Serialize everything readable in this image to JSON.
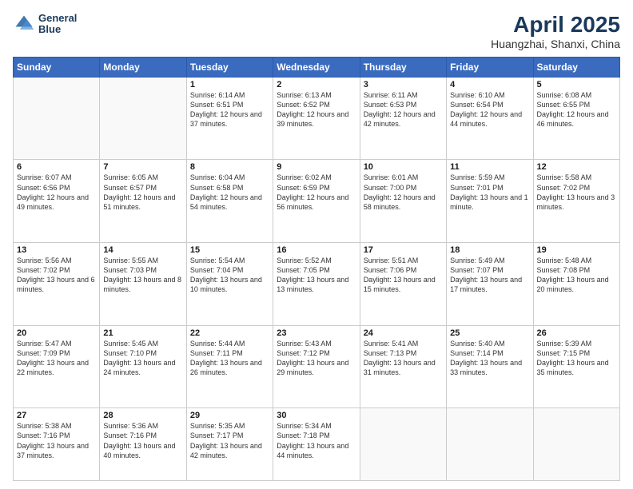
{
  "header": {
    "logo_line1": "General",
    "logo_line2": "Blue",
    "title": "April 2025",
    "subtitle": "Huangzhai, Shanxi, China"
  },
  "days_of_week": [
    "Sunday",
    "Monday",
    "Tuesday",
    "Wednesday",
    "Thursday",
    "Friday",
    "Saturday"
  ],
  "weeks": [
    [
      {
        "day": "",
        "info": ""
      },
      {
        "day": "",
        "info": ""
      },
      {
        "day": "1",
        "info": "Sunrise: 6:14 AM\nSunset: 6:51 PM\nDaylight: 12 hours and 37 minutes."
      },
      {
        "day": "2",
        "info": "Sunrise: 6:13 AM\nSunset: 6:52 PM\nDaylight: 12 hours and 39 minutes."
      },
      {
        "day": "3",
        "info": "Sunrise: 6:11 AM\nSunset: 6:53 PM\nDaylight: 12 hours and 42 minutes."
      },
      {
        "day": "4",
        "info": "Sunrise: 6:10 AM\nSunset: 6:54 PM\nDaylight: 12 hours and 44 minutes."
      },
      {
        "day": "5",
        "info": "Sunrise: 6:08 AM\nSunset: 6:55 PM\nDaylight: 12 hours and 46 minutes."
      }
    ],
    [
      {
        "day": "6",
        "info": "Sunrise: 6:07 AM\nSunset: 6:56 PM\nDaylight: 12 hours and 49 minutes."
      },
      {
        "day": "7",
        "info": "Sunrise: 6:05 AM\nSunset: 6:57 PM\nDaylight: 12 hours and 51 minutes."
      },
      {
        "day": "8",
        "info": "Sunrise: 6:04 AM\nSunset: 6:58 PM\nDaylight: 12 hours and 54 minutes."
      },
      {
        "day": "9",
        "info": "Sunrise: 6:02 AM\nSunset: 6:59 PM\nDaylight: 12 hours and 56 minutes."
      },
      {
        "day": "10",
        "info": "Sunrise: 6:01 AM\nSunset: 7:00 PM\nDaylight: 12 hours and 58 minutes."
      },
      {
        "day": "11",
        "info": "Sunrise: 5:59 AM\nSunset: 7:01 PM\nDaylight: 13 hours and 1 minute."
      },
      {
        "day": "12",
        "info": "Sunrise: 5:58 AM\nSunset: 7:02 PM\nDaylight: 13 hours and 3 minutes."
      }
    ],
    [
      {
        "day": "13",
        "info": "Sunrise: 5:56 AM\nSunset: 7:02 PM\nDaylight: 13 hours and 6 minutes."
      },
      {
        "day": "14",
        "info": "Sunrise: 5:55 AM\nSunset: 7:03 PM\nDaylight: 13 hours and 8 minutes."
      },
      {
        "day": "15",
        "info": "Sunrise: 5:54 AM\nSunset: 7:04 PM\nDaylight: 13 hours and 10 minutes."
      },
      {
        "day": "16",
        "info": "Sunrise: 5:52 AM\nSunset: 7:05 PM\nDaylight: 13 hours and 13 minutes."
      },
      {
        "day": "17",
        "info": "Sunrise: 5:51 AM\nSunset: 7:06 PM\nDaylight: 13 hours and 15 minutes."
      },
      {
        "day": "18",
        "info": "Sunrise: 5:49 AM\nSunset: 7:07 PM\nDaylight: 13 hours and 17 minutes."
      },
      {
        "day": "19",
        "info": "Sunrise: 5:48 AM\nSunset: 7:08 PM\nDaylight: 13 hours and 20 minutes."
      }
    ],
    [
      {
        "day": "20",
        "info": "Sunrise: 5:47 AM\nSunset: 7:09 PM\nDaylight: 13 hours and 22 minutes."
      },
      {
        "day": "21",
        "info": "Sunrise: 5:45 AM\nSunset: 7:10 PM\nDaylight: 13 hours and 24 minutes."
      },
      {
        "day": "22",
        "info": "Sunrise: 5:44 AM\nSunset: 7:11 PM\nDaylight: 13 hours and 26 minutes."
      },
      {
        "day": "23",
        "info": "Sunrise: 5:43 AM\nSunset: 7:12 PM\nDaylight: 13 hours and 29 minutes."
      },
      {
        "day": "24",
        "info": "Sunrise: 5:41 AM\nSunset: 7:13 PM\nDaylight: 13 hours and 31 minutes."
      },
      {
        "day": "25",
        "info": "Sunrise: 5:40 AM\nSunset: 7:14 PM\nDaylight: 13 hours and 33 minutes."
      },
      {
        "day": "26",
        "info": "Sunrise: 5:39 AM\nSunset: 7:15 PM\nDaylight: 13 hours and 35 minutes."
      }
    ],
    [
      {
        "day": "27",
        "info": "Sunrise: 5:38 AM\nSunset: 7:16 PM\nDaylight: 13 hours and 37 minutes."
      },
      {
        "day": "28",
        "info": "Sunrise: 5:36 AM\nSunset: 7:16 PM\nDaylight: 13 hours and 40 minutes."
      },
      {
        "day": "29",
        "info": "Sunrise: 5:35 AM\nSunset: 7:17 PM\nDaylight: 13 hours and 42 minutes."
      },
      {
        "day": "30",
        "info": "Sunrise: 5:34 AM\nSunset: 7:18 PM\nDaylight: 13 hours and 44 minutes."
      },
      {
        "day": "",
        "info": ""
      },
      {
        "day": "",
        "info": ""
      },
      {
        "day": "",
        "info": ""
      }
    ]
  ]
}
